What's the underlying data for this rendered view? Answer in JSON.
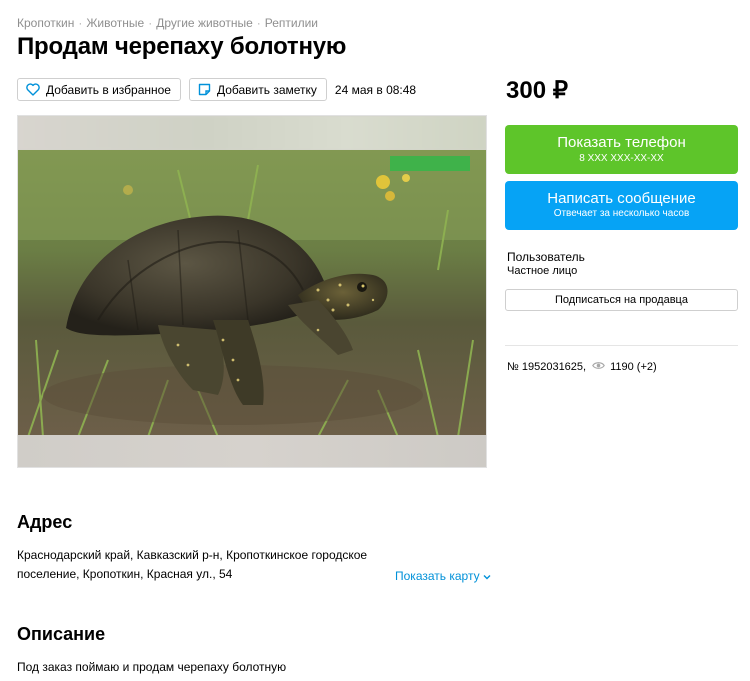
{
  "breadcrumbs": [
    "Кропоткин",
    "Животные",
    "Другие животные",
    "Рептилии"
  ],
  "breadcrumb_sep": "·",
  "title": "Продам черепаху болотную",
  "actions": {
    "favorite_label": "Добавить в избранное",
    "note_label": "Добавить заметку",
    "date": "24 мая в 08:48"
  },
  "price": "300 ₽",
  "contact": {
    "phone_label": "Показать телефон",
    "phone_masked": "8 XXX XXX-XX-XX",
    "message_label": "Написать сообщение",
    "message_sub": "Отвечает за несколько часов"
  },
  "seller": {
    "name": "Пользователь",
    "type": "Частное лицо",
    "subscribe_label": "Подписаться на продавца"
  },
  "listing": {
    "number": "№ 1952031625,",
    "views": "1190 (+2)"
  },
  "address": {
    "heading": "Адрес",
    "text": "Краснодарский край, Кавказский р-н, Кропоткинское городское поселение, Кропоткин, Красная ул., 54",
    "map_link": "Показать карту"
  },
  "description": {
    "heading": "Описание",
    "text": "Под заказ поймаю и продам черепаху болотную"
  },
  "colors": {
    "phone_button": "#5ec52a",
    "message_button": "#06a3f5",
    "link": "#0091d9",
    "muted": "#8f8f8f"
  },
  "icons": {
    "favorite": "heart-icon",
    "note": "note-icon",
    "views": "eye-icon",
    "map_link": "chevron-down-icon"
  }
}
